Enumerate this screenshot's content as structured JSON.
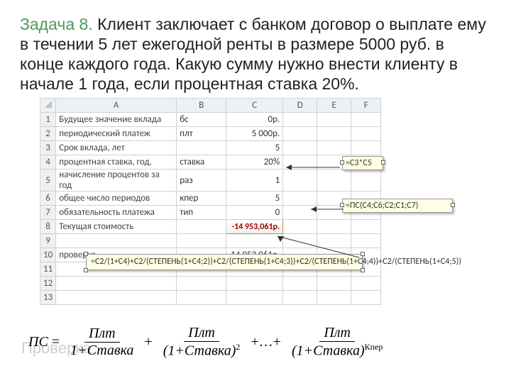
{
  "title": {
    "task_label": "Задача 8.",
    "text_rest": " Клиент заключает с банком договор о выплате ему в течении 5 лет ежегодной ренты в размере 5000 руб. в конце каждого года. Какую сумму нужно внести клиенту в начале 1 года, если процентная ставка 20%."
  },
  "sheet": {
    "cols": [
      "",
      "A",
      "B",
      "C",
      "D",
      "E",
      "F"
    ],
    "rows": [
      {
        "n": "1",
        "A": "Будущее значение вклада",
        "B": "бс",
        "C": "0р."
      },
      {
        "n": "2",
        "A": "периодический платеж",
        "B": "плт",
        "C": "5 000р."
      },
      {
        "n": "3",
        "A": "Срок вклада, лет",
        "B": "",
        "C": "5"
      },
      {
        "n": "4",
        "A": "процентная ставка, год.",
        "B": "ставка",
        "C": "20%"
      },
      {
        "n": "5",
        "A": "начисление процентов за год",
        "B": "раз",
        "C": "1"
      },
      {
        "n": "6",
        "A": "общее число периодов",
        "B": "кпер",
        "C": "5"
      },
      {
        "n": "7",
        "A": "обязательность платежа",
        "B": "тип",
        "C": "0"
      },
      {
        "n": "8",
        "A": "Текущая стоимость",
        "B": "",
        "C": "-14 953,061р."
      },
      {
        "n": "9",
        "A": "",
        "B": "",
        "C": ""
      },
      {
        "n": "10",
        "A": "проверка",
        "B": "",
        "C": "14 953,061р."
      },
      {
        "n": "11",
        "A": "",
        "B": "",
        "C": ""
      },
      {
        "n": "12",
        "A": "",
        "B": "",
        "C": ""
      },
      {
        "n": "13",
        "A": "",
        "B": "",
        "C": ""
      }
    ]
  },
  "callouts": {
    "c1": "=C3*C5",
    "c2": "=ПС(C4;C6;C2;C1;C7)",
    "c3": "=C2/(1+C4)+C2/(СТЕПЕНЬ(1+C4;2))+C2/(СТЕПЕНЬ(1+C4;3))+C2/(СТЕПЕНЬ(1+C4;4))+C2/(СТЕПЕНЬ(1+C4;5))"
  },
  "check_label": "Проверка:",
  "formula": {
    "lhs": "ПС",
    "eq": "=",
    "term_num": "Плт",
    "den1": "1+Ставка",
    "den2_base": "(1+Ставка)",
    "den2_pow": "2",
    "dots": "+…+",
    "denN_base": "(1+Ставка)",
    "denN_pow": "Кпер"
  }
}
